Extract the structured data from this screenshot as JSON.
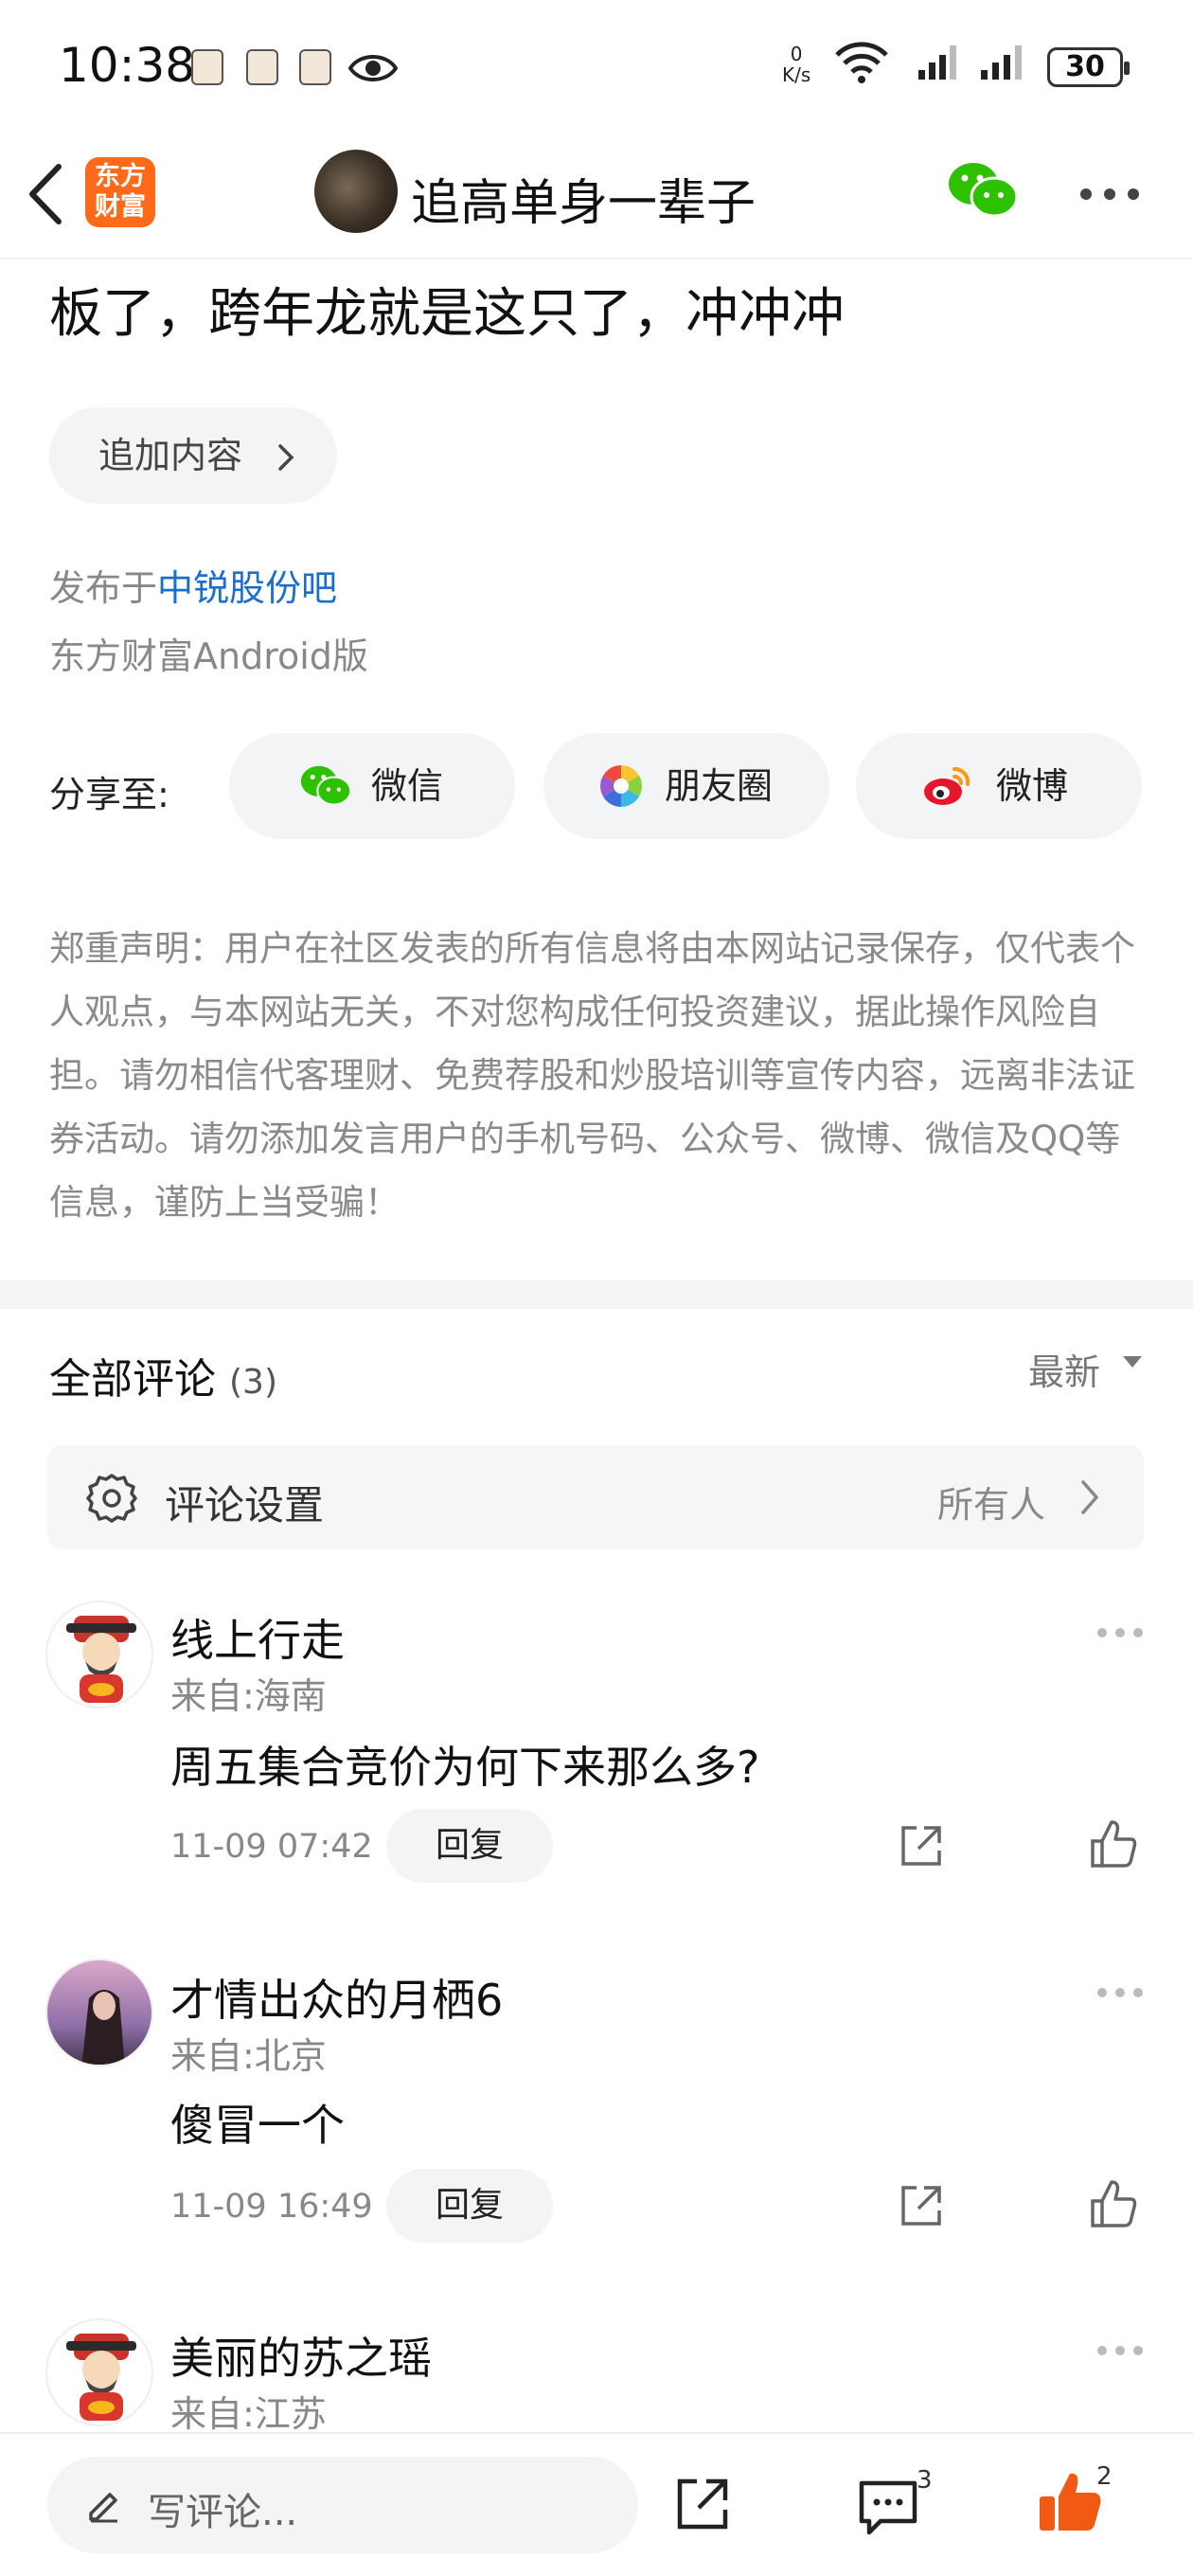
{
  "status_bar": {
    "time": "10:38",
    "net_speed_value": "0",
    "net_speed_unit": "K/s",
    "battery": "30"
  },
  "nav": {
    "logo_line1": "东方",
    "logo_line2": "财富",
    "title": "追高单身一辈子"
  },
  "post": {
    "text": "板了，跨年龙就是这只了，冲冲冲",
    "append_label": "追加内容",
    "published_prefix": "发布于",
    "published_bar": "中锐股份吧",
    "client": "东方财富Android版"
  },
  "share": {
    "label": "分享至:",
    "wechat": "微信",
    "moments": "朋友圈",
    "weibo": "微博"
  },
  "disclaimer": "郑重声明：用户在社区发表的所有信息将由本网站记录保存，仅代表个人观点，与本网站无关，不对您构成任何投资建议，据此操作风险自担。请勿相信代客理财、免费荐股和炒股培训等宣传内容，远离非法证券活动。请勿添加发言用户的手机号码、公众号、微博、微信及QQ等信息，谨防上当受骗！",
  "comments": {
    "title": "全部评论",
    "count": "(3)",
    "sort": "最新",
    "settings_label": "评论设置",
    "settings_value": "所有人",
    "reply_label": "回复",
    "items": [
      {
        "user": "线上行走",
        "location": "来自:海南",
        "text": "周五集合竞价为何下来那么多?",
        "time": "11-09 07:42"
      },
      {
        "user": "才情出众的月栖6",
        "location": "来自:北京",
        "text": "傻冒一个",
        "time": "11-09 16:49"
      },
      {
        "user": "美丽的苏之瑶",
        "location": "来自:江苏"
      }
    ]
  },
  "bottom_bar": {
    "write_placeholder": "写评论...",
    "comment_count": "3",
    "like_count": "2"
  },
  "colors": {
    "brand_orange": "#ff6a1a",
    "link_blue": "#1a6fce",
    "wechat_green": "#2dc100",
    "like_orange": "#f25a14"
  }
}
